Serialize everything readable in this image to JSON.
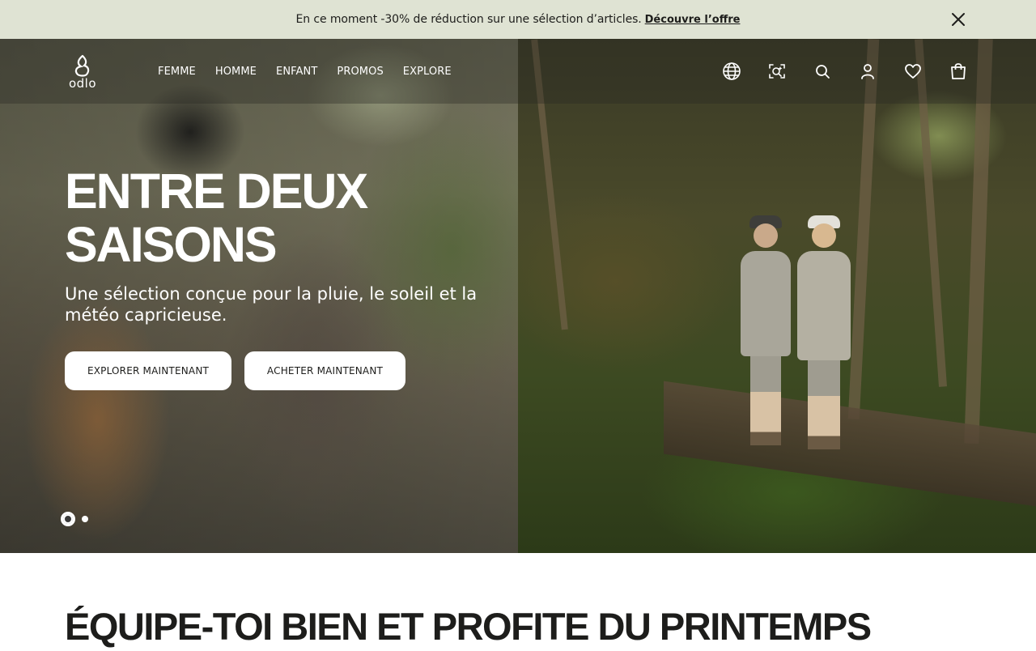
{
  "promo_banner": {
    "text": "En ce moment -30% de réduction sur une sélection d’articles.",
    "link_label": "Découvre l’offre",
    "background_color": "#dfe3d3",
    "close_icon": "close-icon"
  },
  "header": {
    "logo_text": "odlo",
    "nav_items": [
      {
        "label": "FEMME"
      },
      {
        "label": "HOMME"
      },
      {
        "label": "ENFANT"
      },
      {
        "label": "PROMOS"
      },
      {
        "label": "EXPLORE"
      }
    ],
    "icons": [
      "globe-icon",
      "visual-search-icon",
      "search-icon",
      "account-icon",
      "wishlist-heart-icon",
      "shopping-bag-icon"
    ]
  },
  "hero": {
    "headline_line1": "ENTRE DEUX",
    "headline_line2": "SAISONS",
    "subheadline": "Une sélection conçue pour la pluie, le soleil et la météo capricieuse.",
    "buttons": {
      "explore": "EXPLORER MAINTENANT",
      "buy": "ACHETER MAINTENANT"
    },
    "carousel": {
      "slide_count": 2,
      "active_slide": 1
    }
  },
  "section": {
    "title": "ÉQUIPE-TOI BIEN ET PROFITE DU PRINTEMPS"
  }
}
